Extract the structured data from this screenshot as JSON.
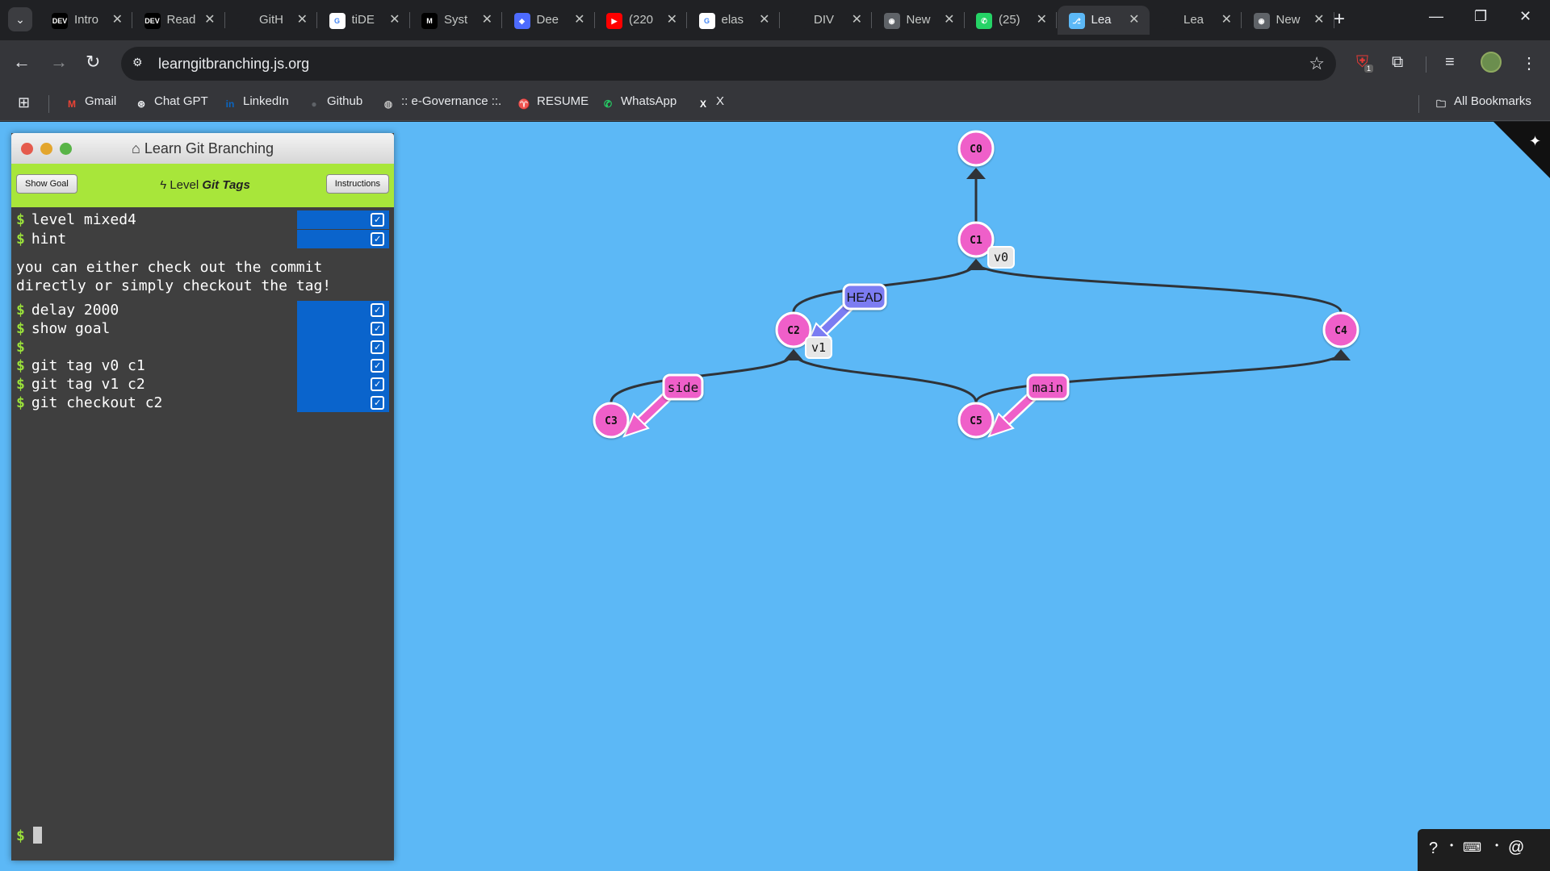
{
  "browser": {
    "tabs": [
      {
        "title": "Intro",
        "favicon": "DEV",
        "favicon_bg": "#000000",
        "active": false
      },
      {
        "title": "Read",
        "favicon": "DEV",
        "favicon_bg": "#000000",
        "active": false
      },
      {
        "title": "GitH",
        "favicon": "",
        "favicon_bg": "#202124",
        "active": false
      },
      {
        "title": "tiDE",
        "favicon": "G",
        "favicon_bg": "#ffffff",
        "active": false
      },
      {
        "title": "Syst",
        "favicon": "M",
        "favicon_bg": "#000000",
        "active": false
      },
      {
        "title": "Dee",
        "favicon": "◆",
        "favicon_bg": "#4d6bfe",
        "active": false
      },
      {
        "title": "(220",
        "favicon": "▶",
        "favicon_bg": "#ff0000",
        "active": false
      },
      {
        "title": "elas",
        "favicon": "G",
        "favicon_bg": "#ffffff",
        "active": false
      },
      {
        "title": "DIV",
        "favicon": "",
        "favicon_bg": "#202124",
        "active": false
      },
      {
        "title": "New",
        "favicon": "◉",
        "favicon_bg": "#5f6368",
        "active": false
      },
      {
        "title": "(25)",
        "favicon": "✆",
        "favicon_bg": "#25d366",
        "active": false
      },
      {
        "title": "Lea",
        "favicon": "⎇",
        "favicon_bg": "#5cb8f6",
        "active": true
      },
      {
        "title": "Lea",
        "favicon": "",
        "favicon_bg": "#202124",
        "active": false
      },
      {
        "title": "New",
        "favicon": "◉",
        "favicon_bg": "#5f6368",
        "active": false
      }
    ],
    "url": "learngitbranching.js.org",
    "extension_badge": "1",
    "bookmarks": [
      {
        "label": "Gmail",
        "icon": "M",
        "color": "#ea4335"
      },
      {
        "label": "Chat GPT",
        "icon": "⊛",
        "color": "#e8eaed"
      },
      {
        "label": "LinkedIn",
        "icon": "in",
        "color": "#0a66c2"
      },
      {
        "label": "Github",
        "icon": "●",
        "color": "#5f6368"
      },
      {
        "label": ":: e-Governance ::.",
        "icon": "◍",
        "color": "#bdbdbd"
      },
      {
        "label": "RESUME",
        "icon": "♈",
        "color": "#4caf50"
      },
      {
        "label": "WhatsApp",
        "icon": "✆",
        "color": "#25d366"
      },
      {
        "label": "X",
        "icon": "X",
        "color": "#ffffff"
      }
    ],
    "all_bookmarks": "All Bookmarks"
  },
  "terminal": {
    "window_title": "Learn Git Branching",
    "show_goal": "Show Goal",
    "instructions": "Instructions",
    "level_prefix": "Level",
    "level_name": "Git Tags",
    "commands_top": [
      "level mixed4",
      "hint"
    ],
    "hint": "you can either check out the commit directly or simply checkout the tag!",
    "commands_bottom": [
      "delay 2000",
      "show goal",
      "",
      "git tag v0 c1",
      "git tag v1 c2",
      "git checkout c2"
    ],
    "prompt": "$"
  },
  "graph": {
    "commits": [
      "C0",
      "C1",
      "C2",
      "C3",
      "C4",
      "C5"
    ],
    "tags": [
      {
        "name": "v0",
        "commit": "C1"
      },
      {
        "name": "v1",
        "commit": "C2"
      }
    ],
    "branches": [
      {
        "name": "side",
        "commit": "C3"
      },
      {
        "name": "main",
        "commit": "C5"
      }
    ],
    "head": {
      "label": "HEAD",
      "commit": "C2"
    },
    "colors": {
      "commit": "#ef5fc9",
      "head": "#7b7cf2",
      "tag_bg": "#e6e6e6",
      "branch": "#ef5fc9",
      "edge": "#2f3338",
      "background": "#5cb8f6"
    }
  }
}
